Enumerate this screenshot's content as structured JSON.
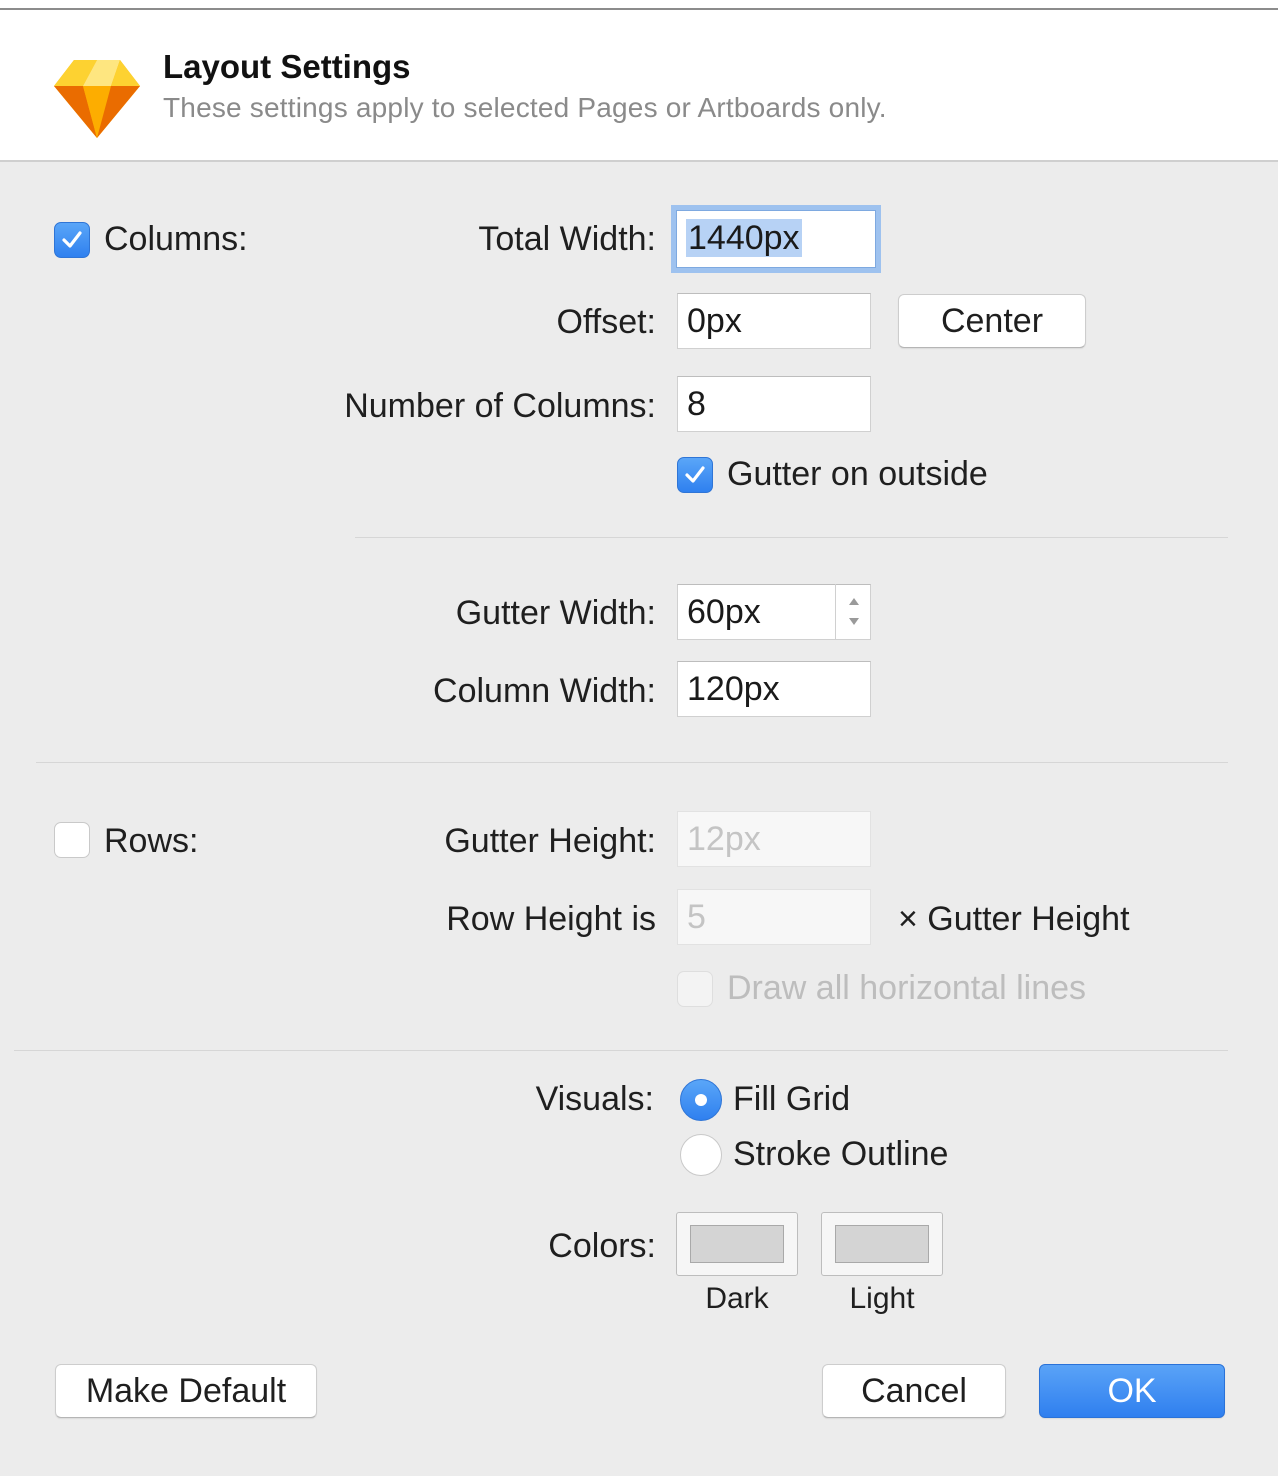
{
  "header": {
    "title": "Layout Settings",
    "subtitle": "These settings apply to selected Pages or Artboards only.",
    "logo_icon": "sketch-diamond-icon"
  },
  "columns": {
    "checkbox_label": "Columns:",
    "checked": true,
    "total_width_label": "Total Width:",
    "total_width_value": "1440px",
    "offset_label": "Offset:",
    "offset_value": "0px",
    "center_button": "Center",
    "number_label": "Number of Columns:",
    "number_value": "8",
    "gutter_outside_label": "Gutter on outside",
    "gutter_outside_checked": true,
    "gutter_width_label": "Gutter Width:",
    "gutter_width_value": "60px",
    "column_width_label": "Column Width:",
    "column_width_value": "120px"
  },
  "rows": {
    "checkbox_label": "Rows:",
    "checked": false,
    "gutter_height_label": "Gutter Height:",
    "gutter_height_value": "12px",
    "row_height_label": "Row Height is",
    "row_height_value": "5",
    "row_height_suffix": "× Gutter Height",
    "draw_lines_label": "Draw all horizontal lines",
    "draw_lines_checked": false
  },
  "visuals": {
    "label": "Visuals:",
    "options": [
      "Fill Grid",
      "Stroke Outline"
    ],
    "selected": "Fill Grid"
  },
  "colors": {
    "label": "Colors:",
    "dark_label": "Dark",
    "light_label": "Light",
    "dark_swatch": "#d4d4d4",
    "light_swatch": "#d4d4d4"
  },
  "footer": {
    "make_default": "Make Default",
    "cancel": "Cancel",
    "ok": "OK"
  },
  "theme": {
    "accent": "#2f80ef",
    "panel_bg": "#ececec"
  }
}
